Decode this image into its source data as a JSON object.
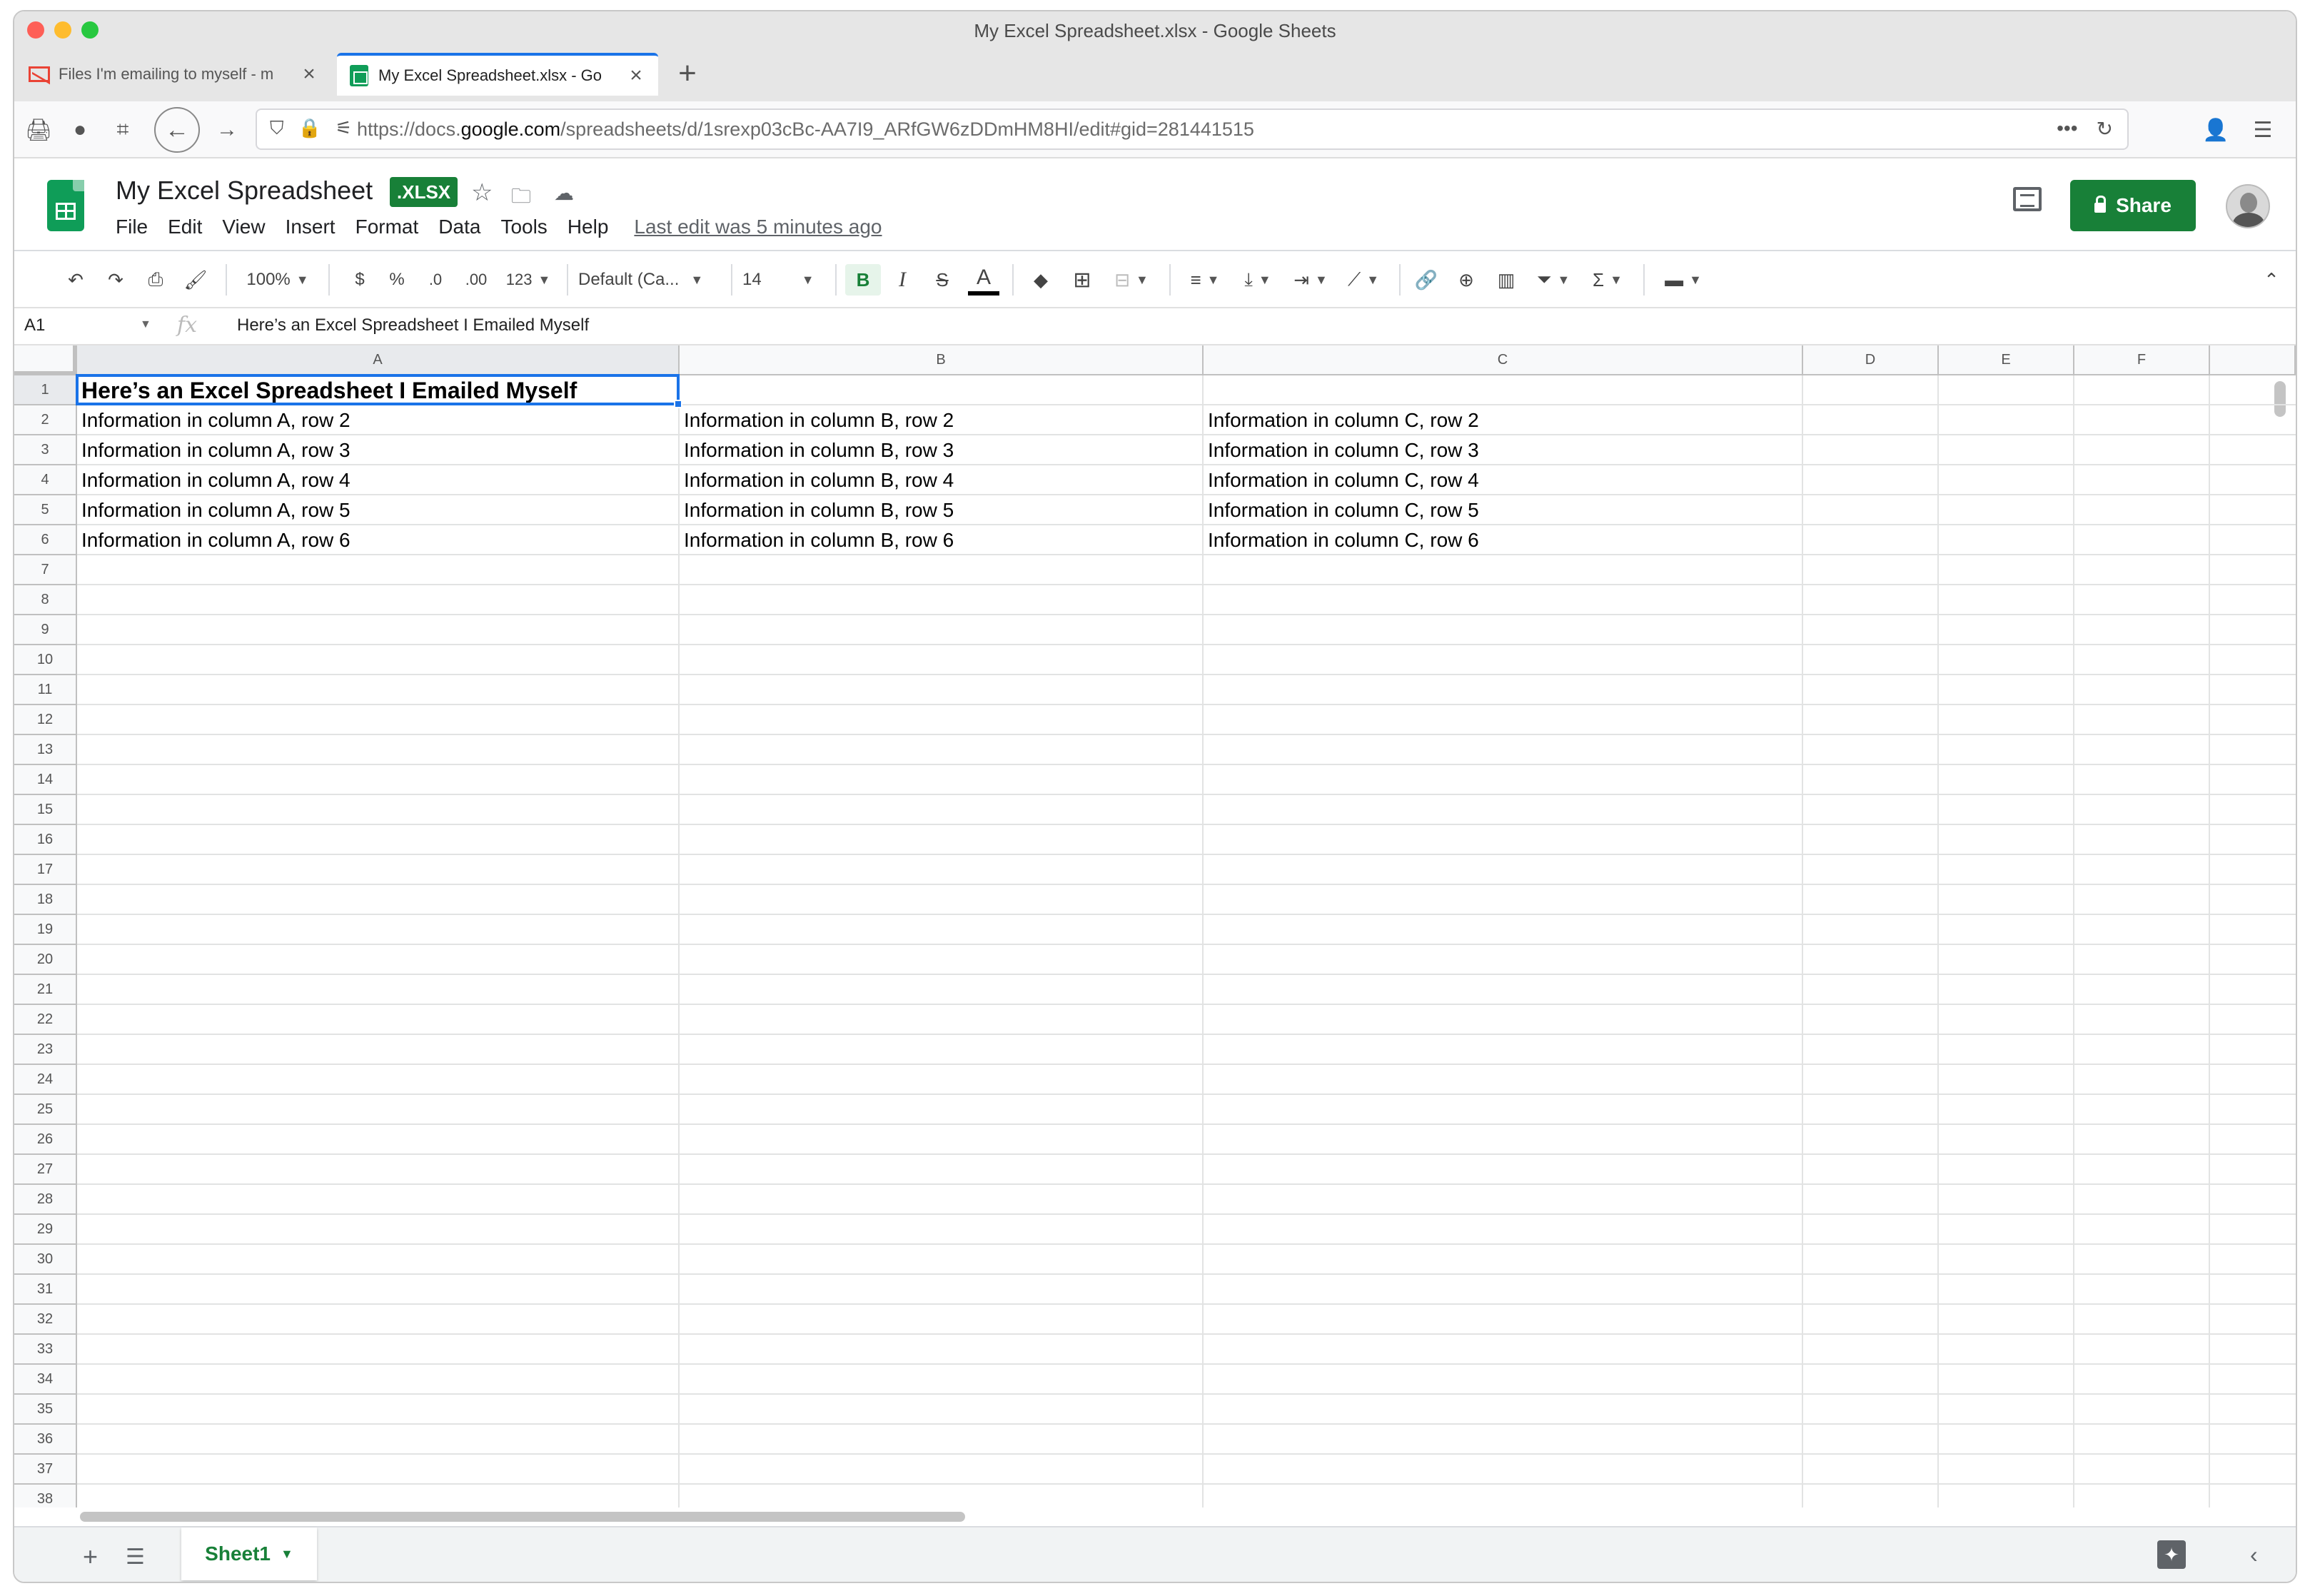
{
  "window": {
    "title": "My Excel Spreadsheet.xlsx - Google Sheets"
  },
  "tabs": [
    {
      "label": "Files I'm emailing to myself - m",
      "icon": "gmail-icon",
      "active": false
    },
    {
      "label": "My Excel Spreadsheet.xlsx - Go",
      "icon": "sheets-icon",
      "active": true
    }
  ],
  "url": {
    "prefix": "https://docs.",
    "domain": "google.com",
    "path": "/spreadsheets/d/1srexp03cBc-AA7I9_ARfGW6zDDmHM8HI/edit#gid=281441515"
  },
  "doc": {
    "title": "My Excel Spreadsheet",
    "badge": ".XLSX",
    "menu": [
      "File",
      "Edit",
      "View",
      "Insert",
      "Format",
      "Data",
      "Tools",
      "Help"
    ],
    "last_edit": "Last edit was 5 minutes ago",
    "share_label": "Share",
    "brand_color": "#188038"
  },
  "toolbar": {
    "zoom": "100%",
    "currency": "$",
    "percent": "%",
    "dec_less": ".0",
    "dec_more": ".00",
    "more_formats": "123",
    "font": "Default (Ca...",
    "font_size": "14",
    "bold": "B",
    "italic": "I",
    "strike": "S",
    "text_color": "A"
  },
  "formula_bar": {
    "cell_ref": "A1",
    "fx": "fx",
    "content": "Here’s an Excel Spreadsheet I Emailed Myself"
  },
  "grid": {
    "columns": [
      "A",
      "B",
      "C",
      "D",
      "E",
      "F"
    ],
    "row_count": 38,
    "rows": [
      [
        "Here’s an Excel Spreadsheet I Emailed Myself",
        "",
        ""
      ],
      [
        "Information in column A, row 2",
        "Information in column B, row 2",
        "Information in column C, row 2"
      ],
      [
        "Information in column A, row 3",
        "Information in column B, row 3",
        "Information in column C, row 3"
      ],
      [
        "Information in column A, row 4",
        "Information in column B, row 4",
        "Information in column C, row 4"
      ],
      [
        "Information in column A, row 5",
        "Information in column B, row 5",
        "Information in column C, row 5"
      ],
      [
        "Information in column A, row 6",
        "Information in column B, row 6",
        "Information in column C, row 6"
      ]
    ],
    "selected_cell": "A1"
  },
  "sheets": {
    "tabs": [
      "Sheet1"
    ]
  }
}
